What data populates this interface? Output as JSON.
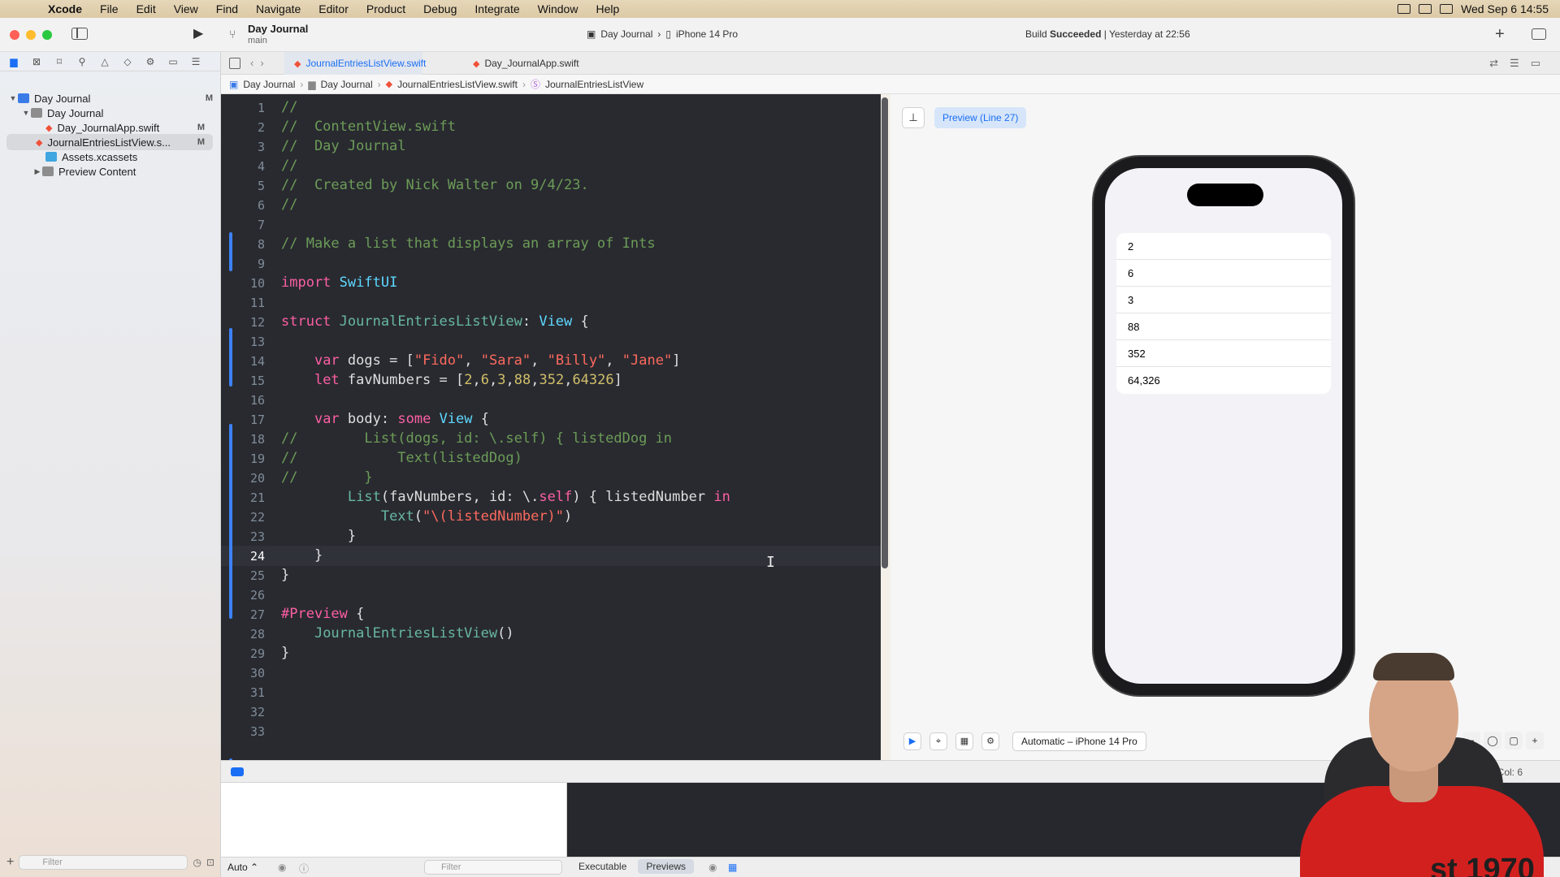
{
  "menubar": {
    "app": "Xcode",
    "items": [
      "File",
      "Edit",
      "View",
      "Find",
      "Navigate",
      "Editor",
      "Product",
      "Debug",
      "Integrate",
      "Window",
      "Help"
    ],
    "clock": "Wed Sep 6  14:55"
  },
  "toolbar": {
    "project_title": "Day Journal",
    "branch": "main",
    "scheme_target": "Day Journal",
    "scheme_device": "iPhone 14 Pro",
    "status_prefix": "Build",
    "status_bold": "Succeeded",
    "status_suffix": "| Yesterday at 22:56",
    "add_label": "+"
  },
  "navigator": {
    "tree": [
      {
        "label": "Day Journal",
        "badge": "M"
      },
      {
        "label": "Day Journal",
        "badge": ""
      },
      {
        "label": "Day_JournalApp.swift",
        "badge": "M"
      },
      {
        "label": "JournalEntriesListView.s...",
        "badge": "M"
      },
      {
        "label": "Assets.xcassets",
        "badge": ""
      },
      {
        "label": "Preview Content",
        "badge": ""
      }
    ],
    "filter_placeholder": "Filter"
  },
  "tabs": [
    {
      "label": "JournalEntriesListView.swift"
    },
    {
      "label": "Day_JournalApp.swift"
    }
  ],
  "jumpbar": [
    "Day Journal",
    "Day Journal",
    "JournalEntriesListView.swift",
    "JournalEntriesListView"
  ],
  "editor": {
    "current_line": "24",
    "lines": [
      {
        "n": "1",
        "t": "//"
      },
      {
        "n": "2",
        "t": "//  ContentView.swift"
      },
      {
        "n": "3",
        "t": "//  Day Journal"
      },
      {
        "n": "4",
        "t": "//"
      },
      {
        "n": "5",
        "t": "//  Created by Nick Walter on 9/4/23."
      },
      {
        "n": "6",
        "t": "//"
      },
      {
        "n": "7",
        "t": ""
      },
      {
        "n": "8",
        "t": "// Make a list that displays an array of Ints"
      },
      {
        "n": "9",
        "t": ""
      },
      {
        "n": "10",
        "t": "import SwiftUI"
      },
      {
        "n": "11",
        "t": ""
      },
      {
        "n": "12",
        "t": "struct JournalEntriesListView: View {"
      },
      {
        "n": "13",
        "t": ""
      },
      {
        "n": "14",
        "t": "    var dogs = [\"Fido\", \"Sara\", \"Billy\", \"Jane\"]"
      },
      {
        "n": "15",
        "t": "    let favNumbers = [2,6,3,88,352,64326]"
      },
      {
        "n": "16",
        "t": ""
      },
      {
        "n": "17",
        "t": "    var body: some View {"
      },
      {
        "n": "18",
        "t": "//        List(dogs, id: \\.self) { listedDog in"
      },
      {
        "n": "19",
        "t": "//            Text(listedDog)"
      },
      {
        "n": "20",
        "t": "//        }"
      },
      {
        "n": "21",
        "t": "        List(favNumbers, id: \\.self) { listedNumber in"
      },
      {
        "n": "22",
        "t": "            Text(\"\\(listedNumber)\")"
      },
      {
        "n": "23",
        "t": "        }"
      },
      {
        "n": "24",
        "t": "    }"
      },
      {
        "n": "25",
        "t": "}"
      },
      {
        "n": "26",
        "t": ""
      },
      {
        "n": "27",
        "t": "#Preview {"
      },
      {
        "n": "28",
        "t": "    JournalEntriesListView()"
      },
      {
        "n": "29",
        "t": "}"
      },
      {
        "n": "30",
        "t": ""
      },
      {
        "n": "31",
        "t": ""
      },
      {
        "n": "32",
        "t": ""
      },
      {
        "n": "33",
        "t": ""
      }
    ]
  },
  "canvas": {
    "preview_chip": "Preview (Line 27)",
    "list_items": [
      "2",
      "6",
      "3",
      "88",
      "352",
      "64,326"
    ],
    "device_select": "Automatic – iPhone 14 Pro"
  },
  "debug": {
    "line_col": "Line: 24  Col: 6",
    "auto_label": "Auto ⌃",
    "filter_placeholder": "Filter",
    "segments": [
      "Executable",
      "Previews"
    ]
  },
  "overlay": {
    "shirt_print": "st 1970"
  }
}
